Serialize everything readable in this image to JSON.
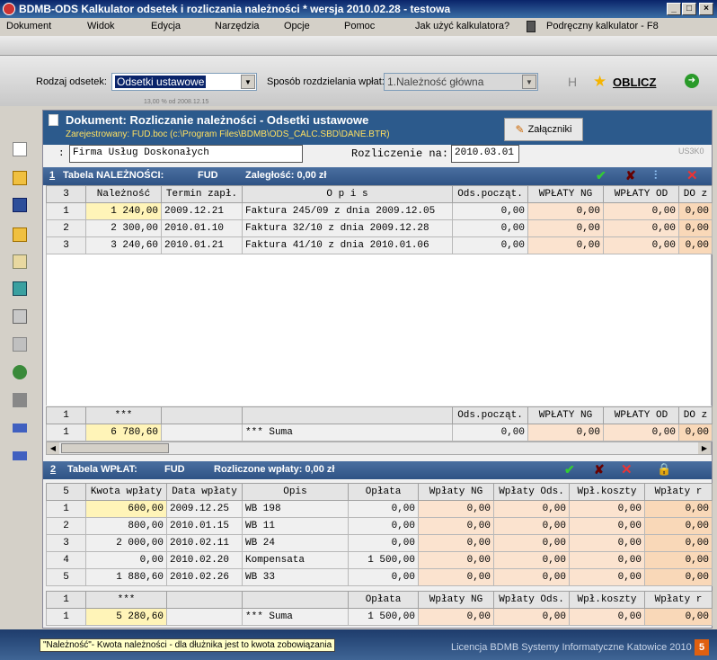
{
  "window": {
    "title": "BDMB-ODS  Kalkulator odsetek i rozliczania należności *  wersja 2010.02.28 - testowa"
  },
  "menu": [
    "Dokument",
    "Widok",
    "Edycja",
    "Narzędzia",
    "Opcje",
    "Pomoc",
    "Jak użyć kalkulatora?",
    "Podręczny kalkulator - F8"
  ],
  "toolbar": {
    "rodzaj_label": "Rodzaj odsetek:",
    "rodzaj_value": "Odsetki ustawowe",
    "rodzaj_hint": "13,00 % od 2008.12.15",
    "sposob_label": "Sposób rozdzielania wpłat:",
    "sposob_value": "1.Należność główna",
    "h_label": "H",
    "oblicz_label": "OBLICZ"
  },
  "doc": {
    "title": "Dokument: Rozliczanie należności - Odsetki ustawowe",
    "registered": "Zarejestrowany: FUD.boc (c:\\Program Files\\BDMB\\ODS_CALC.SBD\\DANE.BTR)",
    "attachments": "Załączniki",
    "firm_prefix": ":",
    "firm": "Firma Usług Doskonałych",
    "rozl_label": "Rozliczenie na:",
    "rozl_date": "2010.03.01",
    "corner": "US3K0"
  },
  "t1": {
    "num": "1",
    "title": "Tabela NALEŻNOŚCI:",
    "code": "FUD",
    "zaleglosc": "Zaległość: 0,00 zł",
    "header": [
      "3",
      "Należność",
      "Termin zapł.",
      "O p i s",
      "Ods.począt.",
      "WPŁATY NG",
      "WPŁATY OD",
      "DO z"
    ],
    "rows": [
      [
        "1",
        "1 240,00",
        "2009.12.21",
        "Faktura 245/09  z dnia 2009.12.05",
        "0,00",
        "0,00",
        "0,00",
        "0,00"
      ],
      [
        "2",
        "2 300,00",
        "2010.01.10",
        "Faktura 32/10  z dnia 2009.12.28",
        "0,00",
        "0,00",
        "0,00",
        "0,00"
      ],
      [
        "3",
        "3 240,60",
        "2010.01.21",
        "Faktura 41/10  z dnia 2010.01.06",
        "0,00",
        "0,00",
        "0,00",
        "0,00"
      ]
    ],
    "sum_header": [
      "1",
      "***",
      "",
      "",
      "Ods.począt.",
      "WPŁATY NG",
      "WPŁATY OD",
      "DO z"
    ],
    "sum_row": [
      "1",
      "6 780,60",
      "",
      "*** Suma",
      "0,00",
      "0,00",
      "0,00",
      "0,00"
    ]
  },
  "t2": {
    "num": "2",
    "title": "Tabela WPŁAT:",
    "code": "FUD",
    "rozliczone": "Rozliczone wpłaty: 0,00 zł",
    "header": [
      "5",
      "Kwota wpłaty",
      "Data wpłaty",
      "Opis",
      "Opłata",
      "Wpłaty  NG",
      "Wpłaty Ods.",
      "Wpł.koszty",
      "Wpłaty r"
    ],
    "rows": [
      [
        "1",
        "600,00",
        "2009.12.25",
        "WB 198",
        "0,00",
        "0,00",
        "0,00",
        "0,00",
        "0,00"
      ],
      [
        "2",
        "800,00",
        "2010.01.15",
        "WB 11",
        "0,00",
        "0,00",
        "0,00",
        "0,00",
        "0,00"
      ],
      [
        "3",
        "2 000,00",
        "2010.02.11",
        "WB 24",
        "0,00",
        "0,00",
        "0,00",
        "0,00",
        "0,00"
      ],
      [
        "4",
        "0,00",
        "2010.02.20",
        "Kompensata",
        "1 500,00",
        "0,00",
        "0,00",
        "0,00",
        "0,00"
      ],
      [
        "5",
        "1 880,60",
        "2010.02.26",
        "WB 33",
        "0,00",
        "0,00",
        "0,00",
        "0,00",
        "0,00"
      ]
    ],
    "sum_header": [
      "1",
      "***",
      "",
      "",
      "Opłata",
      "Wpłaty  NG",
      "Wpłaty Ods.",
      "Wpł.koszty",
      "Wpłaty r"
    ],
    "sum_row": [
      "1",
      "5 280,60",
      "",
      "*** Suma",
      "1 500,00",
      "0,00",
      "0,00",
      "0,00",
      "0,00"
    ]
  },
  "status": {
    "tooltip": "\"Należność\"- Kwota należności - dla dłużnika jest to kwota zobowiązania",
    "license": "Licencja  BDMB Systemy Informatyczne Katowice 2010",
    "badge": "5"
  },
  "colors": {
    "accent": "#2f5385",
    "pink": "#fbe3cf",
    "yellow": "#fff4b8"
  }
}
